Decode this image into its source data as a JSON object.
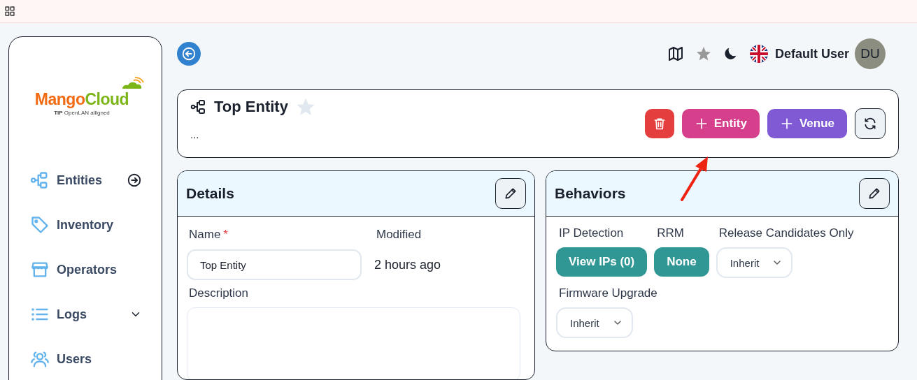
{
  "logo": {
    "name_1": "Mango",
    "name_2": "Cloud",
    "tagline": "**TIP** OpenLAN alligned"
  },
  "sidebar": {
    "items": [
      {
        "label": "Entities",
        "kind": "go"
      },
      {
        "label": "Inventory",
        "kind": "plain"
      },
      {
        "label": "Operators",
        "kind": "plain"
      },
      {
        "label": "Logs",
        "kind": "expand"
      },
      {
        "label": "Users",
        "kind": "plain"
      }
    ]
  },
  "header": {
    "user_name": "Default User",
    "avatar_initials": "DU"
  },
  "entity": {
    "title": "Top Entity",
    "favorite": false,
    "description": "...",
    "buttons": [
      {
        "kind": "delete",
        "color": "#e53e3e"
      },
      {
        "kind": "add",
        "label": "Entity",
        "color": "#d53f8c"
      },
      {
        "kind": "add",
        "label": "Venue",
        "color": "#805ad5"
      },
      {
        "kind": "refresh"
      }
    ]
  },
  "details": {
    "title": "Details",
    "name_label": "Name",
    "required_mark": "*",
    "name_value": "Top Entity",
    "modified_label": "Modified",
    "modified_value": "2 hours ago",
    "description_label": "Description"
  },
  "behaviors": {
    "title": "Behaviors",
    "fields": [
      {
        "label": "IP Detection",
        "kind": "button",
        "value": "View IPs (0)"
      },
      {
        "label": "RRM",
        "kind": "button",
        "value": "None"
      },
      {
        "label": "Release Candidates Only",
        "kind": "select",
        "value": "Inherit"
      },
      {
        "label": "Firmware Upgrade",
        "kind": "select",
        "value": "Inherit"
      }
    ]
  }
}
